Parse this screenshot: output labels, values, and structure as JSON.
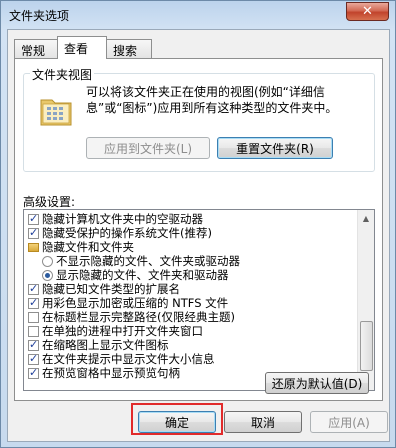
{
  "window": {
    "title": "文件夹选项",
    "close_glyph": "✕"
  },
  "tabs": [
    {
      "label": "常规",
      "active": false
    },
    {
      "label": "查看",
      "active": true
    },
    {
      "label": "搜索",
      "active": false
    }
  ],
  "folder_views": {
    "group_label": "文件夹视图",
    "icon": "folder-view-icon",
    "desc_line1": "可以将该文件夹正在使用的视图(例如“详细信",
    "desc_line2": "息”或“图标”)应用到所有这种类型的文件夹中。",
    "apply_button": "应用到文件夹(L)",
    "reset_button": "重置文件夹(R)"
  },
  "advanced": {
    "label": "高级设置:",
    "items": [
      {
        "type": "checkbox",
        "checked": true,
        "indent": 0,
        "label": "隐藏计算机文件夹中的空驱动器"
      },
      {
        "type": "checkbox",
        "checked": true,
        "indent": 0,
        "label": "隐藏受保护的操作系统文件(推荐)"
      },
      {
        "type": "folder",
        "indent": 0,
        "label": "隐藏文件和文件夹"
      },
      {
        "type": "radio",
        "checked": false,
        "indent": 1,
        "label": "不显示隐藏的文件、文件夹或驱动器"
      },
      {
        "type": "radio",
        "checked": true,
        "indent": 1,
        "label": "显示隐藏的文件、文件夹和驱动器"
      },
      {
        "type": "checkbox",
        "checked": true,
        "indent": 0,
        "label": "隐藏已知文件类型的扩展名"
      },
      {
        "type": "checkbox",
        "checked": true,
        "indent": 0,
        "label": "用彩色显示加密或压缩的 NTFS 文件"
      },
      {
        "type": "checkbox",
        "checked": false,
        "indent": 0,
        "label": "在标题栏显示完整路径(仅限经典主题)"
      },
      {
        "type": "checkbox",
        "checked": false,
        "indent": 0,
        "label": "在单独的进程中打开文件夹窗口"
      },
      {
        "type": "checkbox",
        "checked": true,
        "indent": 0,
        "label": "在缩略图上显示文件图标"
      },
      {
        "type": "checkbox",
        "checked": true,
        "indent": 0,
        "label": "在文件夹提示中显示文件大小信息"
      },
      {
        "type": "checkbox",
        "checked": true,
        "indent": 0,
        "label": "在预览窗格中显示预览句柄"
      }
    ],
    "restore_button": "还原为默认值(D)"
  },
  "footer": {
    "ok_button": "确定",
    "cancel_button": "取消",
    "apply_button": "应用(A)"
  },
  "colors": {
    "highlight": "#e12b2b",
    "close": "#c1432c"
  }
}
